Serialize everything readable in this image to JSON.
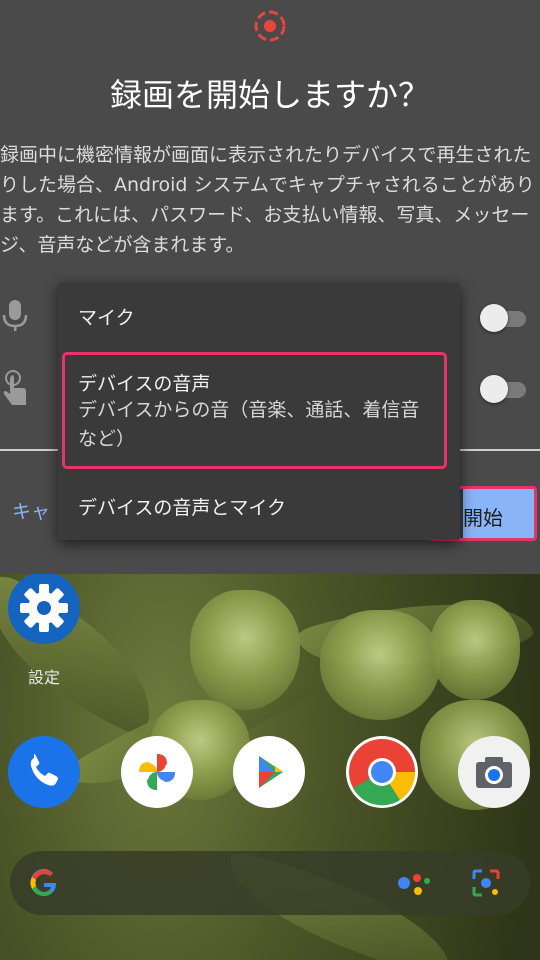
{
  "dialog": {
    "title": "録画を開始しますか？",
    "description": "録画中に機密情報が画面に表示されたりデバイスで再生されたりした場合、Android システムでキャプチャされることがあります。これには、パスワード、お支払い情報、写真、メッセージ、音声などが含まれます。",
    "cancel_label": "キャ",
    "start_label": "開始"
  },
  "menu": {
    "items": [
      {
        "label": "マイク"
      },
      {
        "label": "デバイスの音声",
        "sub": "デバイスからの音（音楽、通話、着信音など）"
      },
      {
        "label": "デバイスの音声とマイク"
      }
    ]
  },
  "home": {
    "settings_label": "設定"
  },
  "colors": {
    "accent": "#8ab4f8",
    "highlight": "#e8336a",
    "record": "#e8453c"
  }
}
